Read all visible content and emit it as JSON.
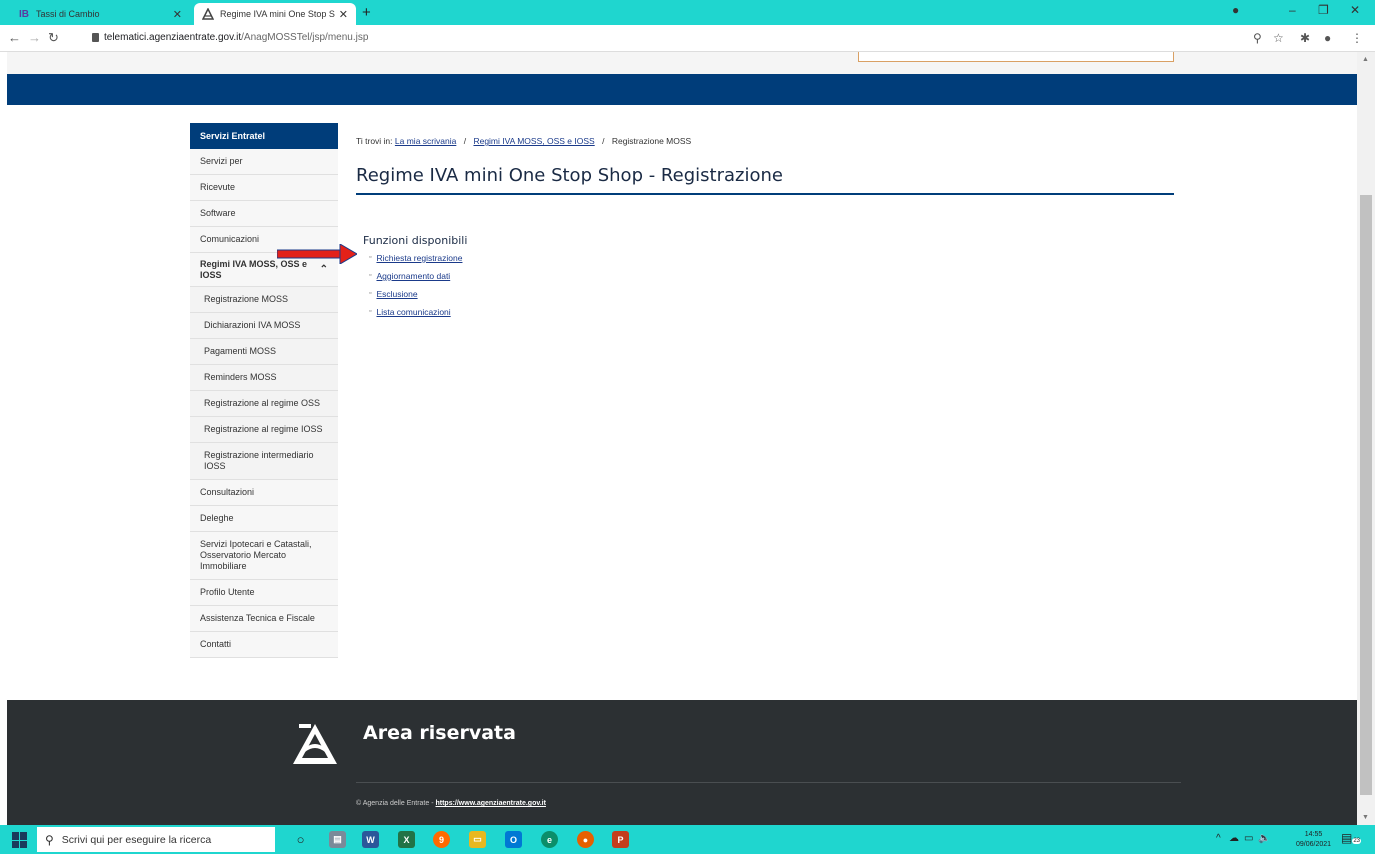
{
  "browser": {
    "tabs": [
      {
        "title": "Tassi di Cambio",
        "favicon": "IB"
      },
      {
        "title": "Regime IVA mini One Stop Shop",
        "favicon": "ae"
      }
    ],
    "url_host": "telematici.agenziaentrate.gov.it",
    "url_path": "/AnagMOSSTel/jsp/menu.jsp"
  },
  "sidebar": {
    "header": "Servizi Entratel",
    "items": [
      "Servizi per",
      "Ricevute",
      "Software",
      "Comunicazioni"
    ],
    "open_section": "Regimi IVA MOSS, OSS e IOSS",
    "sub_items": [
      "Registrazione MOSS",
      "Dichiarazioni IVA MOSS",
      "Pagamenti MOSS",
      "Reminders MOSS",
      "Registrazione al regime OSS",
      "Registrazione al regime IOSS",
      "Registrazione intermediario IOSS"
    ],
    "items_after": [
      "Consultazioni",
      "Deleghe",
      "Servizi Ipotecari e Catastali, Osservatorio Mercato Immobiliare",
      "Profilo Utente",
      "Assistenza Tecnica e Fiscale",
      "Contatti"
    ]
  },
  "breadcrumb": {
    "prefix": "Ti trovi in:",
    "link1": "La mia scrivania",
    "link2": "Regimi IVA MOSS, OSS e IOSS",
    "current": "Registrazione MOSS"
  },
  "main": {
    "title": "Regime IVA mini One Stop Shop - Registrazione",
    "functions_title": "Funzioni disponibili",
    "functions": [
      "Richiesta registrazione",
      "Aggiornamento dati",
      "Esclusione",
      "Lista comunicazioni"
    ]
  },
  "footer": {
    "title": "Area riservata",
    "copyright": "© Agenzia delle Entrate - ",
    "link": "https://www.agenziaentrate.gov.it"
  },
  "taskbar": {
    "search_placeholder": "Scrivi qui per eseguire la ricerca",
    "time": "14:55",
    "date": "09/06/2021",
    "notifications": "23"
  },
  "colors": {
    "chrome": "#1fd6cf",
    "brand_blue": "#003d7a",
    "footer": "#2c3033",
    "arrow": "#e32119"
  }
}
